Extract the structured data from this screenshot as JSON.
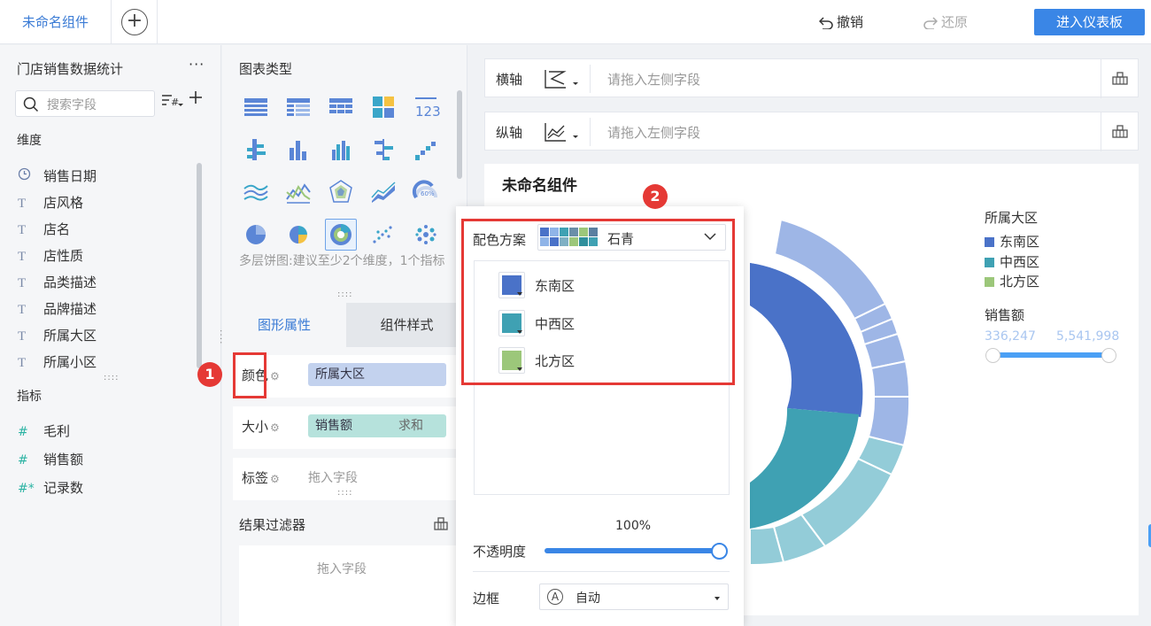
{
  "topbar": {
    "active_tab": "未命名组件",
    "add_tab": "+",
    "undo_label": "撤销",
    "redo_label": "还原",
    "enter_dashboard_label": "进入仪表板"
  },
  "data_panel": {
    "dataset_title": "门店销售数据统计",
    "more_label": "···",
    "search_placeholder": "搜索字段",
    "dimensions_label": "维度",
    "dimensions": [
      {
        "type": "date",
        "label": "销售日期"
      },
      {
        "type": "text",
        "label": "店风格"
      },
      {
        "type": "text",
        "label": "店名"
      },
      {
        "type": "text",
        "label": "店性质"
      },
      {
        "type": "text",
        "label": "品类描述"
      },
      {
        "type": "text",
        "label": "品牌描述"
      },
      {
        "type": "text",
        "label": "所属大区"
      },
      {
        "type": "text",
        "label": "所属小区"
      }
    ],
    "metrics_label": "指标",
    "metrics": [
      {
        "type": "number",
        "label": "毛利"
      },
      {
        "type": "number",
        "label": "销售额"
      },
      {
        "type": "number-count",
        "label": "记录数"
      }
    ]
  },
  "type_panel": {
    "title": "图表类型",
    "hint": "多层饼图:建议至少2个维度，1个指标",
    "tab_graphic": "图形属性",
    "tab_style": "组件样式",
    "color_label": "颜色",
    "color_field": "所属大区",
    "size_label": "大小",
    "size_field": "销售额",
    "size_agg": "求和",
    "tag_label": "标签",
    "tag_placeholder": "拖入字段",
    "filter_title": "结果过滤器",
    "filter_placeholder": "拖入字段"
  },
  "canvas": {
    "x_axis_label": "横轴",
    "y_axis_label": "纵轴",
    "axis_placeholder": "请拖入左侧字段",
    "chart_title": "未命名组件",
    "legend_title": "所属大区",
    "legend": [
      {
        "label": "东南区",
        "color": "#4a72c8"
      },
      {
        "label": "中西区",
        "color": "#3fa1b3"
      },
      {
        "label": "北方区",
        "color": "#9cc77a"
      }
    ],
    "size_legend_title": "销售额",
    "size_min": "336,247",
    "size_max": "5,541,998"
  },
  "color_popover": {
    "scheme_label": "配色方案",
    "scheme_name": "石青",
    "scheme_colors": [
      "#4a72c8",
      "#8fb4e8",
      "#3fa1b3",
      "#6a8fa8",
      "#9cc77a",
      "#5a7fa0",
      "#2f8f9c",
      "#7fb0c4"
    ],
    "items": [
      {
        "label": "东南区",
        "color": "#4a72c8"
      },
      {
        "label": "中西区",
        "color": "#3fa1b3"
      },
      {
        "label": "北方区",
        "color": "#9cc77a"
      }
    ],
    "opacity_label": "不透明度",
    "opacity_value": "100%",
    "opacity_fraction": 1.0,
    "border_label": "边框",
    "border_value": "自动"
  },
  "callouts": {
    "badge1": "1",
    "badge2": "2"
  },
  "colors": {
    "accent": "#3a86e6",
    "callout": "#e53935"
  }
}
